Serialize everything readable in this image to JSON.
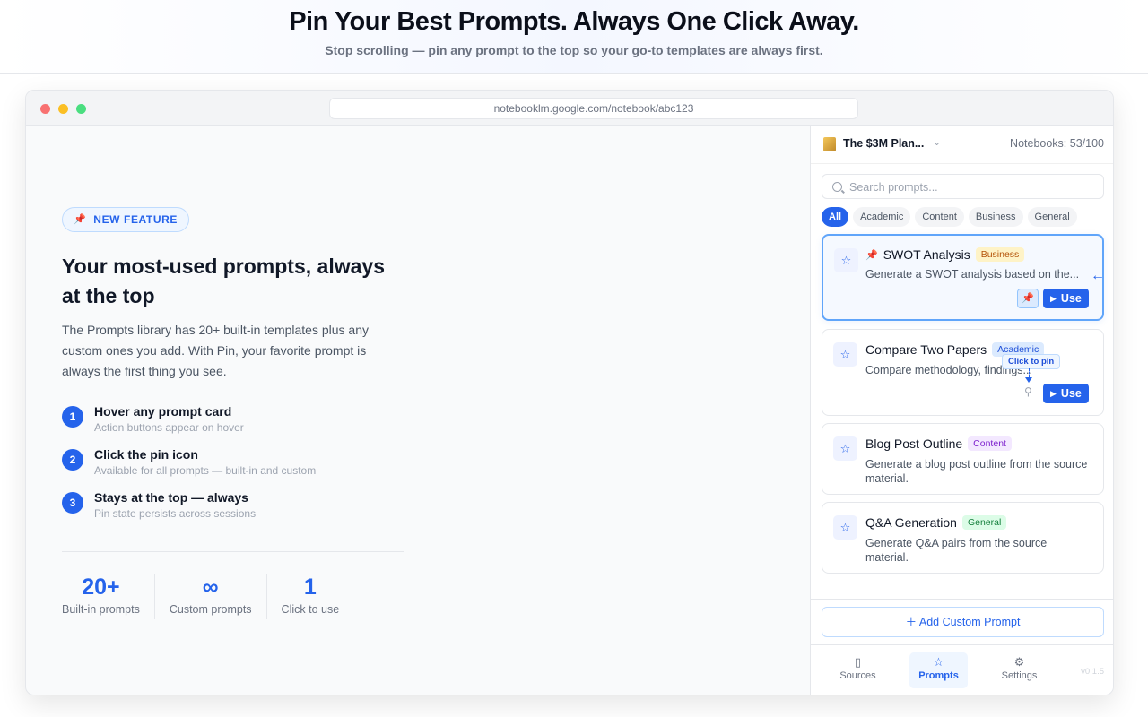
{
  "hero": {
    "title": "Pin Your Best Prompts. Always One Click Away.",
    "subtitle": "Stop scrolling — pin any prompt to the top so your go-to templates are always first."
  },
  "browser": {
    "url": "notebooklm.google.com/notebook/abc123"
  },
  "feature": {
    "badge": "NEW FEATURE",
    "headline": "Your most-used prompts, always at the top",
    "description": "The Prompts library has 20+ built-in templates plus any custom ones you add. With Pin, your favorite prompt is always the first thing you see.",
    "steps": [
      {
        "num": "1",
        "title": "Hover any prompt card",
        "sub": "Action buttons appear on hover"
      },
      {
        "num": "2",
        "title": "Click the pin icon",
        "sub": "Available for all prompts — built-in and custom"
      },
      {
        "num": "3",
        "title": "Stays at the top — always",
        "sub": "Pin state persists across sessions"
      }
    ],
    "stats": [
      {
        "value": "20+",
        "label": "Built-in prompts"
      },
      {
        "value": "∞",
        "label": "Custom prompts"
      },
      {
        "value": "1",
        "label": "Click to use"
      }
    ]
  },
  "panel": {
    "notebook_name": "The $3M Plan...",
    "notebook_count": "Notebooks: 53/100",
    "search_placeholder": "Search prompts...",
    "filters": [
      "All",
      "Academic",
      "Content",
      "Business",
      "General"
    ],
    "active_filter": "All",
    "cards": [
      {
        "title": "SWOT Analysis",
        "tag": "Business",
        "desc": "Generate a SWOT analysis based on the...",
        "pinned": true,
        "use_label": "Use"
      },
      {
        "title": "Compare Two Papers",
        "tag": "Academic",
        "desc": "Compare methodology, findings...",
        "pinned": false,
        "use_label": "Use",
        "tooltip": "Click to pin"
      },
      {
        "title": "Blog Post Outline",
        "tag": "Content",
        "desc": "Generate a blog post outline from the source material.",
        "pinned": false
      },
      {
        "title": "Q&A Generation",
        "tag": "General",
        "desc": "Generate Q&A pairs from the source material.",
        "pinned": false
      }
    ],
    "add_button": "Add Custom Prompt",
    "nav": [
      {
        "label": "Sources",
        "icon": "book-icon"
      },
      {
        "label": "Prompts",
        "icon": "star-icon"
      },
      {
        "label": "Settings",
        "icon": "gear-icon"
      }
    ],
    "active_nav": "Prompts",
    "version": "v0.1.5"
  },
  "colors": {
    "accent": "#2563eb",
    "business_tag": "#fef3c7",
    "academic_tag": "#dbeafe",
    "content_tag": "#f3e8ff",
    "general_tag": "#dcfce7"
  }
}
